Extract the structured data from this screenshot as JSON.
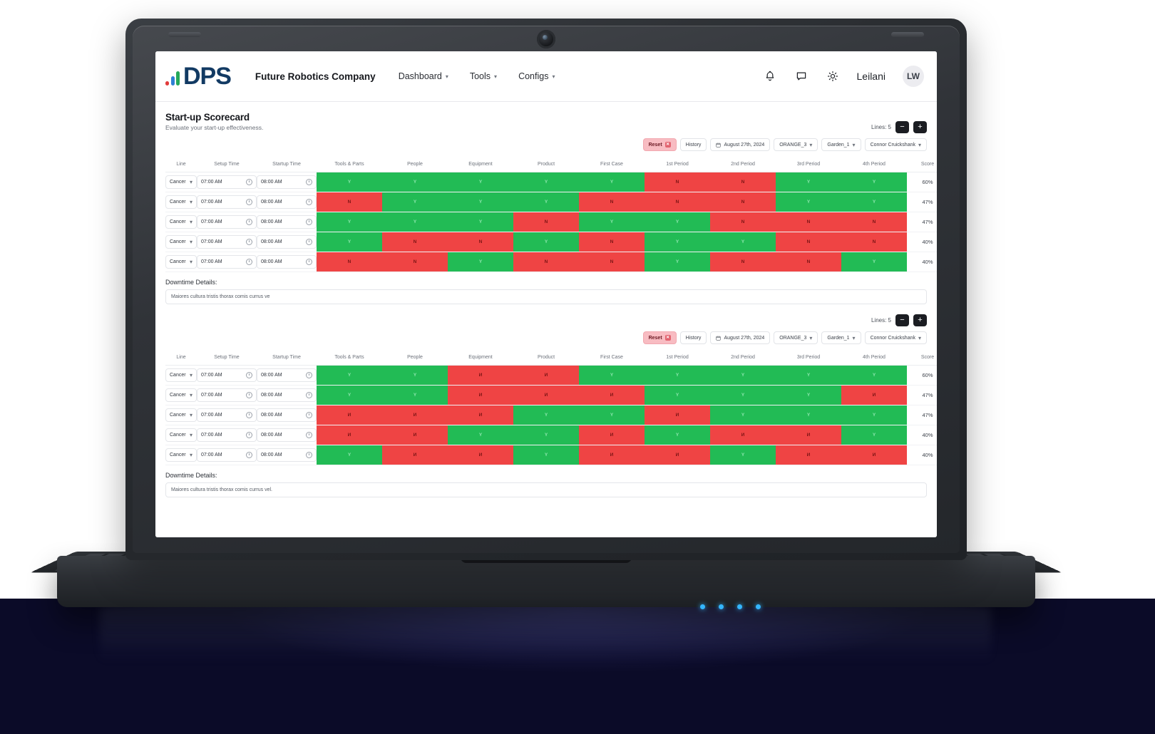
{
  "header": {
    "logo_text": "DPS",
    "logo_bar_colors": [
      "#e23b3b",
      "#2f7fd4",
      "#25a85a"
    ],
    "brand": "Future Robotics Company",
    "nav": [
      {
        "label": "Dashboard",
        "caret": "chevron-down-icon"
      },
      {
        "label": "Tools",
        "caret": "chevron-down-icon"
      },
      {
        "label": "Configs",
        "caret": "chevron-down-icon"
      }
    ],
    "icons": [
      "bell-icon",
      "chat-icon",
      "brightness-icon"
    ],
    "user_name": "Leilani",
    "avatar_initials": "LW"
  },
  "page": {
    "title": "Start-up Scorecard",
    "subtitle": "Evaluate your start-up effectiveness."
  },
  "toolbar": {
    "lines_label": "Lines: 5",
    "minus_label": "−",
    "plus_label": "+",
    "filters": [
      {
        "label": "Reset",
        "kind": "reset",
        "close": "✕"
      },
      {
        "label": "History",
        "kind": "plain"
      },
      {
        "label": "August 27th, 2024",
        "kind": "date",
        "icon": "calendar-icon"
      },
      {
        "label": "ORANGE_3",
        "kind": "select",
        "caret": "˅"
      },
      {
        "label": "Garden_1",
        "kind": "select",
        "caret": "˅"
      },
      {
        "label": "Connor Cruickshank",
        "kind": "select",
        "caret": "˅"
      }
    ]
  },
  "table": {
    "columns": [
      "Line",
      "Setup Time",
      "Startup Time",
      "Tools & Parts",
      "People",
      "Equipment",
      "Product",
      "First Case",
      "1st Period",
      "2nd Period",
      "3rd Period",
      "4th Period",
      "Score"
    ],
    "line_value": "Cancer",
    "setup_time": "07:00 AM",
    "startup_time": "08:00 AM"
  },
  "downtime": {
    "label": "Downtime Details:",
    "value_top": "Maiores cultura tristis thorax comis currus ve",
    "value_bottom": "Maiores cultura tristis thorax comis currus vel."
  },
  "scorecards": [
    {
      "yes_glyph": "Y",
      "no_glyph": "N",
      "rows": [
        {
          "score": "60%",
          "cells": [
            "Y",
            "Y",
            "Y",
            "Y",
            "Y",
            "N",
            "N",
            "Y",
            "Y"
          ]
        },
        {
          "score": "47%",
          "cells": [
            "N",
            "Y",
            "Y",
            "Y",
            "N",
            "N",
            "N",
            "Y",
            "Y"
          ]
        },
        {
          "score": "47%",
          "cells": [
            "Y",
            "Y",
            "Y",
            "N",
            "Y",
            "Y",
            "N",
            "N",
            "N"
          ]
        },
        {
          "score": "40%",
          "cells": [
            "Y",
            "N",
            "N",
            "Y",
            "N",
            "Y",
            "Y",
            "N",
            "N"
          ]
        },
        {
          "score": "40%",
          "cells": [
            "N",
            "N",
            "Y",
            "N",
            "N",
            "Y",
            "N",
            "N",
            "Y"
          ]
        }
      ]
    },
    {
      "yes_glyph": "Y",
      "no_glyph": "И",
      "rows": [
        {
          "score": "60%",
          "cells": [
            "Y",
            "Y",
            "N",
            "N",
            "Y",
            "Y",
            "Y",
            "Y",
            "Y"
          ]
        },
        {
          "score": "47%",
          "cells": [
            "Y",
            "Y",
            "N",
            "N",
            "N",
            "Y",
            "Y",
            "Y",
            "N"
          ]
        },
        {
          "score": "47%",
          "cells": [
            "N",
            "N",
            "N",
            "Y",
            "Y",
            "N",
            "Y",
            "Y",
            "Y"
          ]
        },
        {
          "score": "40%",
          "cells": [
            "N",
            "N",
            "Y",
            "Y",
            "N",
            "Y",
            "N",
            "N",
            "Y"
          ]
        },
        {
          "score": "40%",
          "cells": [
            "Y",
            "N",
            "N",
            "Y",
            "N",
            "N",
            "Y",
            "N",
            "N"
          ]
        }
      ]
    }
  ]
}
